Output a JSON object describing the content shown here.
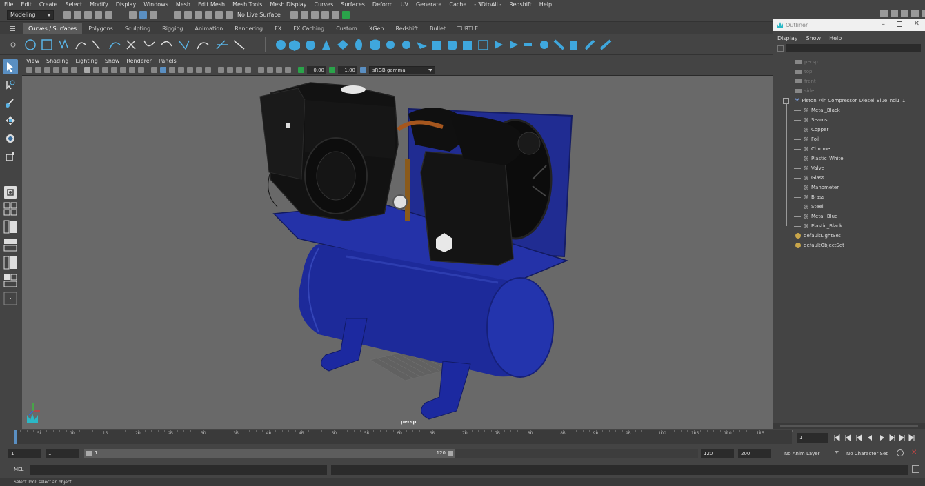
{
  "menubar": [
    "File",
    "Edit",
    "Create",
    "Select",
    "Modify",
    "Display",
    "Windows",
    "Mesh",
    "Edit Mesh",
    "Mesh Tools",
    "Mesh Display",
    "Curves",
    "Surfaces",
    "Deform",
    "UV",
    "Generate",
    "Cache",
    "- 3DtoAll -",
    "Redshift",
    "Help"
  ],
  "status": {
    "mode": "Modeling",
    "live_surface": "No Live Surface"
  },
  "shelf_tabs": [
    "Curves / Surfaces",
    "Polygons",
    "Sculpting",
    "Rigging",
    "Animation",
    "Rendering",
    "FX",
    "FX Caching",
    "Custom",
    "XGen",
    "Redshift",
    "Bullet",
    "TURTLE"
  ],
  "viewport": {
    "menu": [
      "View",
      "Shading",
      "Lighting",
      "Show",
      "Renderer",
      "Panels"
    ],
    "exposure": "0.00",
    "gamma": "1.00",
    "color_space": "sRGB gamma",
    "camera_label": "persp"
  },
  "outliner": {
    "title": "Outliner",
    "menu": [
      "Display",
      "Show",
      "Help"
    ],
    "cameras": [
      "persp",
      "top",
      "front",
      "side"
    ],
    "root": "Piston_Air_Compressor_Diesel_Blue_ncl1_1",
    "children": [
      "Metal_Black",
      "Seams",
      "Copper",
      "Foil",
      "Chrome",
      "Plastic_White",
      "Valve",
      "Glass",
      "Manometer",
      "Brass",
      "Steel",
      "Metal_Blue",
      "Plastic_Black"
    ],
    "sets": [
      "defaultLightSet",
      "defaultObjectSet"
    ]
  },
  "timeline": {
    "ticks": [
      "5",
      "10",
      "15",
      "20",
      "25",
      "30",
      "35",
      "40",
      "45",
      "50",
      "55",
      "60",
      "65",
      "70",
      "75",
      "80",
      "85",
      "90",
      "95",
      "100",
      "105",
      "110",
      "115"
    ],
    "start_label": "1",
    "current_frame": "1",
    "current_fraction": 0.0
  },
  "range": {
    "start": "1",
    "inner_start": "1",
    "slider_start": "1",
    "slider_end": "120",
    "end": "120",
    "max": "200",
    "anim_layer": "No Anim Layer",
    "char_set": "No Character Set"
  },
  "cmdline": {
    "label": "MEL"
  },
  "help": {
    "text": "Select Tool: select an object"
  },
  "colors": {
    "accent": "#5a8fc2",
    "tank": "#1f2a8a",
    "engine": "#1a1a1a",
    "viewport_bg": "#696969"
  }
}
